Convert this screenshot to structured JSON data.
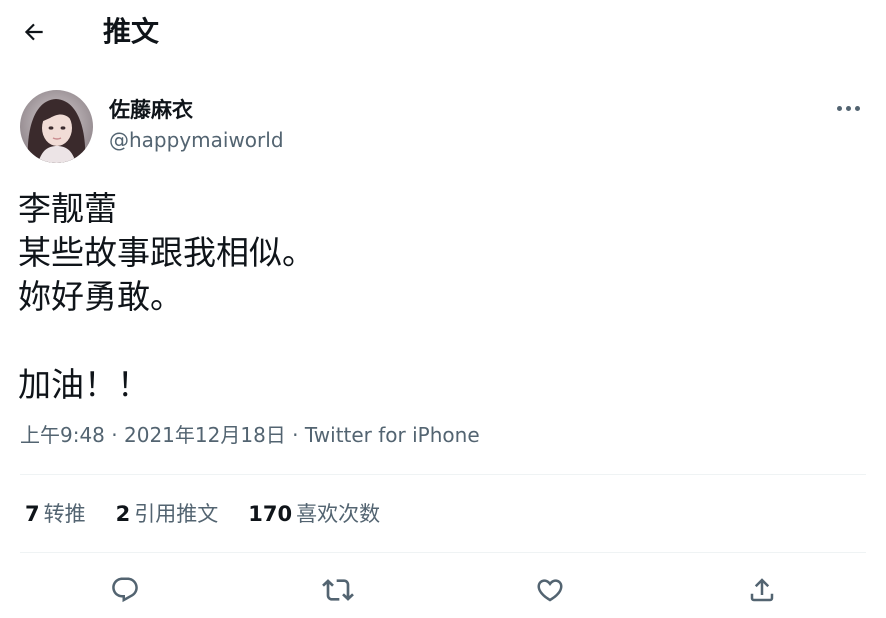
{
  "header": {
    "title": "推文",
    "back_icon": "arrow-left-icon"
  },
  "author": {
    "display_name": "佐藤麻衣",
    "handle": "@happymaiworld",
    "more_icon": "more-horizontal-icon"
  },
  "tweet": {
    "lines": [
      "李靓蕾",
      "某些故事跟我相似。",
      "妳好勇敢。",
      "",
      "加油！！"
    ]
  },
  "meta": {
    "time": "上午9:48",
    "sep1": " · ",
    "date": "2021年12月18日",
    "sep2": " · ",
    "client": "Twitter for iPhone"
  },
  "stats": {
    "retweets": {
      "count": "7",
      "label": "转推"
    },
    "quotes": {
      "count": "2",
      "label": "引用推文"
    },
    "likes": {
      "count": "170",
      "label": "喜欢次数"
    }
  },
  "actions": {
    "reply_icon": "reply-icon",
    "retweet_icon": "retweet-icon",
    "like_icon": "heart-icon",
    "share_icon": "share-icon"
  },
  "colors": {
    "text": "#0f1419",
    "secondary": "#536471",
    "divider": "#eff3f4"
  }
}
